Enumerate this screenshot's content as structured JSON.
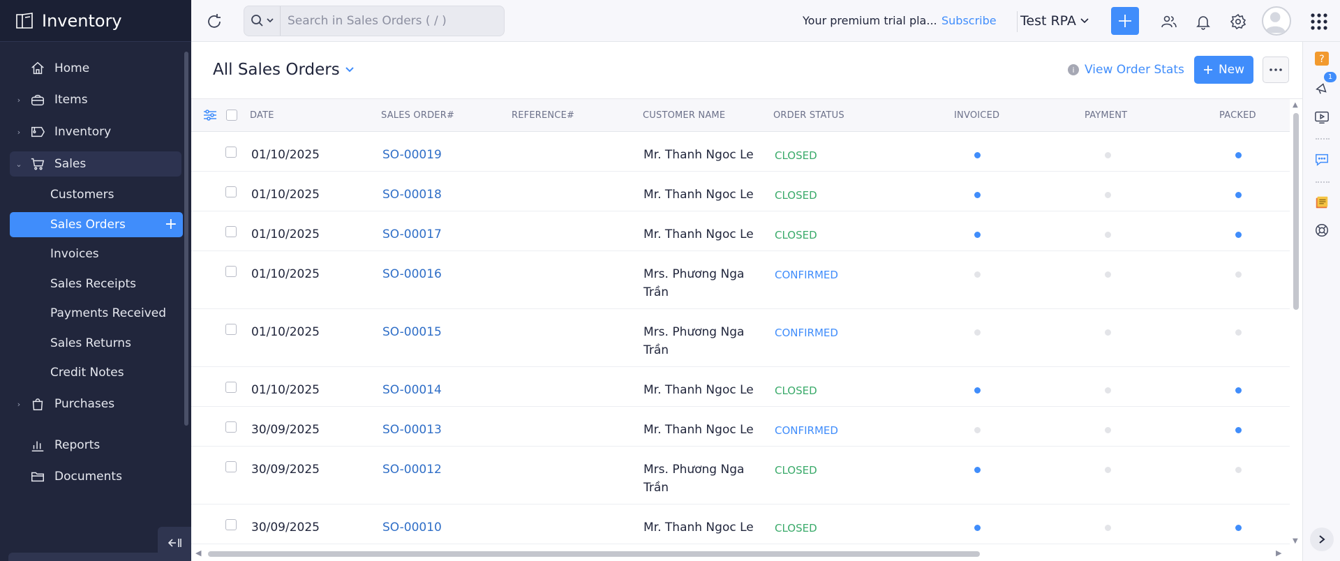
{
  "app": {
    "name": "Inventory"
  },
  "sidebar": {
    "items": [
      {
        "label": "Home",
        "icon": "home-icon"
      },
      {
        "label": "Items",
        "icon": "bag-icon"
      },
      {
        "label": "Inventory",
        "icon": "tag-icon"
      },
      {
        "label": "Sales",
        "icon": "cart-icon"
      },
      {
        "label": "Purchases",
        "icon": "shopping-bag-icon"
      },
      {
        "label": "Reports",
        "icon": "bar-chart-icon"
      },
      {
        "label": "Documents",
        "icon": "folder-icon"
      }
    ],
    "sales_sub": [
      "Customers",
      "Sales Orders",
      "Invoices",
      "Sales Receipts",
      "Payments Received",
      "Sales Returns",
      "Credit Notes"
    ],
    "active_sub": "Sales Orders"
  },
  "topbar": {
    "search_placeholder": "Search in Sales Orders ( / )",
    "trial_text": "Your premium trial pla...",
    "subscribe_label": "Subscribe",
    "org_name": "Test RPA"
  },
  "header": {
    "title": "All Sales Orders",
    "view_stats_label": "View Order Stats",
    "new_label": "New"
  },
  "table": {
    "columns": [
      "DATE",
      "SALES ORDER#",
      "REFERENCE#",
      "CUSTOMER NAME",
      "ORDER STATUS",
      "INVOICED",
      "PAYMENT",
      "PACKED"
    ],
    "rows": [
      {
        "date": "01/10/2025",
        "order": "SO-00019",
        "reference": "",
        "customer": "Mr. Thanh Ngoc Le",
        "status": "CLOSED",
        "invoiced": true,
        "payment": false,
        "packed": true
      },
      {
        "date": "01/10/2025",
        "order": "SO-00018",
        "reference": "",
        "customer": "Mr. Thanh Ngoc Le",
        "status": "CLOSED",
        "invoiced": true,
        "payment": false,
        "packed": true
      },
      {
        "date": "01/10/2025",
        "order": "SO-00017",
        "reference": "",
        "customer": "Mr. Thanh Ngoc Le",
        "status": "CLOSED",
        "invoiced": true,
        "payment": false,
        "packed": true
      },
      {
        "date": "01/10/2025",
        "order": "SO-00016",
        "reference": "",
        "customer": "Mrs. Phương Nga Trần",
        "status": "CONFIRMED",
        "invoiced": false,
        "payment": false,
        "packed": false
      },
      {
        "date": "01/10/2025",
        "order": "SO-00015",
        "reference": "",
        "customer": "Mrs. Phương Nga Trần",
        "status": "CONFIRMED",
        "invoiced": false,
        "payment": false,
        "packed": false
      },
      {
        "date": "01/10/2025",
        "order": "SO-00014",
        "reference": "",
        "customer": "Mr. Thanh Ngoc Le",
        "status": "CLOSED",
        "invoiced": true,
        "payment": false,
        "packed": true
      },
      {
        "date": "30/09/2025",
        "order": "SO-00013",
        "reference": "",
        "customer": "Mr. Thanh Ngoc Le",
        "status": "CONFIRMED",
        "invoiced": false,
        "payment": false,
        "packed": true
      },
      {
        "date": "30/09/2025",
        "order": "SO-00012",
        "reference": "",
        "customer": "Mrs. Phương Nga Trần",
        "status": "CLOSED",
        "invoiced": true,
        "payment": false,
        "packed": false
      },
      {
        "date": "30/09/2025",
        "order": "SO-00010",
        "reference": "",
        "customer": "Mr. Thanh Ngoc Le",
        "status": "CLOSED",
        "invoiced": true,
        "payment": false,
        "packed": true
      }
    ]
  },
  "rail": {
    "notification_count": "1"
  },
  "colors": {
    "accent": "#408dfb",
    "sidebar_bg": "#21263c",
    "closed": "#3aaa6a",
    "confirmed": "#408dfb"
  }
}
